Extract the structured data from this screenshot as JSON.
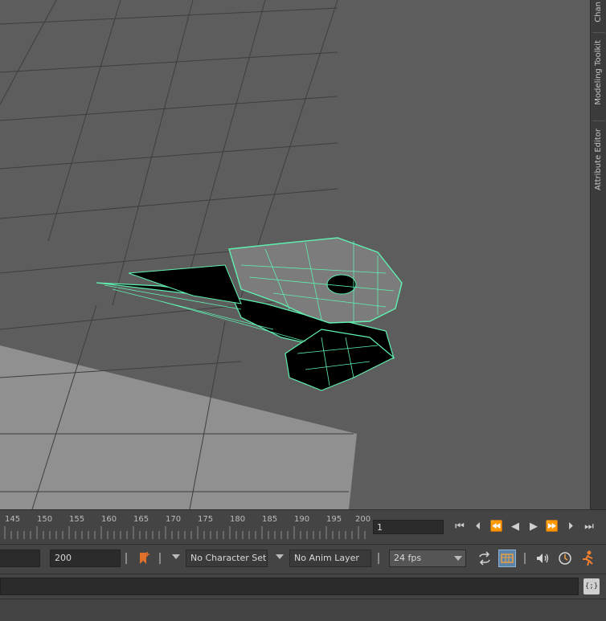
{
  "side_tabs": [
    {
      "label": "Chan"
    },
    {
      "label": "Modeling Toolkit"
    },
    {
      "label": "Attribute Editor"
    }
  ],
  "timeline": {
    "ticks": [
      "145",
      "150",
      "155",
      "160",
      "165",
      "170",
      "175",
      "180",
      "185",
      "190",
      "195",
      "200"
    ],
    "current_frame": "1"
  },
  "playback": {
    "buttons": [
      {
        "name": "go-to-start-icon",
        "glyph": "⏮"
      },
      {
        "name": "step-back-key-icon",
        "glyph": "⏴"
      },
      {
        "name": "step-back-frame-icon",
        "glyph": "⏪"
      },
      {
        "name": "play-backward-icon",
        "glyph": "◀"
      },
      {
        "name": "play-forward-icon",
        "glyph": "▶"
      },
      {
        "name": "step-forward-frame-icon",
        "glyph": "⏩"
      },
      {
        "name": "step-forward-key-icon",
        "glyph": "⏵"
      },
      {
        "name": "go-to-end-icon",
        "glyph": "⏭"
      }
    ]
  },
  "range": {
    "end_value": "200",
    "character_set": "No Character Set",
    "anim_layer": "No Anim Layer",
    "fps": "24 fps"
  },
  "colors": {
    "wireframe": "#5ff0b0",
    "viewport": "#5d5d5d",
    "accent": "#e0702a"
  },
  "command_line": {
    "script_icon": "{;}"
  }
}
